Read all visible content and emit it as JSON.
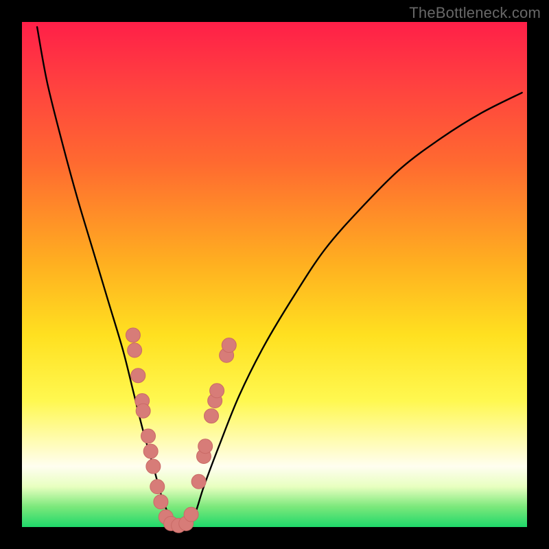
{
  "watermark": "TheBottleneck.com",
  "colors": {
    "frame_bg_top": "#ff1f48",
    "frame_bg_mid": "#ffe020",
    "frame_bg_bottom": "#1fd86a",
    "curve": "#000000",
    "marker_fill": "#d77c78",
    "marker_stroke": "#c96a66"
  },
  "chart_data": {
    "type": "line",
    "title": "",
    "xlabel": "",
    "ylabel": "",
    "xlim": [
      0,
      100
    ],
    "ylim": [
      0,
      100
    ],
    "notes": "V-shaped bottleneck curve. y ≈ 100 corresponds to top (red), y ≈ 0 corresponds to bottom (green). Minimum sits near x ≈ 28–33 at y ≈ 0.",
    "series": [
      {
        "name": "bottleneck-curve",
        "x": [
          3,
          5,
          8,
          11,
          14,
          17,
          20,
          22,
          24,
          26,
          28,
          30,
          32,
          34,
          36,
          39,
          43,
          48,
          54,
          60,
          67,
          75,
          83,
          91,
          99
        ],
        "y": [
          99,
          88,
          76,
          65,
          55,
          45,
          35,
          27,
          19,
          12,
          5,
          1,
          0,
          2,
          8,
          16,
          26,
          36,
          46,
          55,
          63,
          71,
          77,
          82,
          86
        ]
      }
    ],
    "markers": {
      "name": "highlighted-points",
      "style": "salmon-dots",
      "points": [
        {
          "x": 22.0,
          "y": 38
        },
        {
          "x": 22.3,
          "y": 35
        },
        {
          "x": 23.0,
          "y": 30
        },
        {
          "x": 23.8,
          "y": 25
        },
        {
          "x": 24.0,
          "y": 23
        },
        {
          "x": 25.0,
          "y": 18
        },
        {
          "x": 25.5,
          "y": 15
        },
        {
          "x": 26.0,
          "y": 12
        },
        {
          "x": 26.8,
          "y": 8
        },
        {
          "x": 27.5,
          "y": 5
        },
        {
          "x": 28.5,
          "y": 2
        },
        {
          "x": 29.5,
          "y": 0.7
        },
        {
          "x": 31.0,
          "y": 0.3
        },
        {
          "x": 32.5,
          "y": 0.7
        },
        {
          "x": 33.5,
          "y": 2.5
        },
        {
          "x": 35.0,
          "y": 9
        },
        {
          "x": 36.0,
          "y": 14
        },
        {
          "x": 36.3,
          "y": 16
        },
        {
          "x": 37.5,
          "y": 22
        },
        {
          "x": 38.2,
          "y": 25
        },
        {
          "x": 38.6,
          "y": 27
        },
        {
          "x": 40.5,
          "y": 34
        },
        {
          "x": 41.0,
          "y": 36
        }
      ]
    }
  }
}
